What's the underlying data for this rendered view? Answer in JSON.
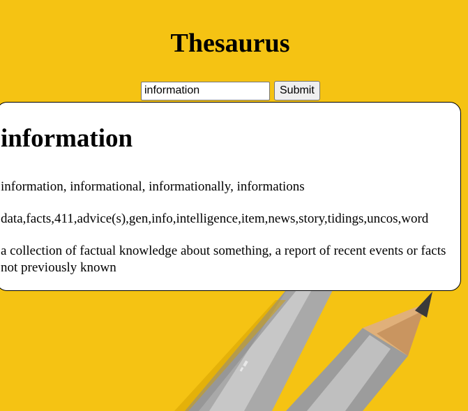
{
  "header": {
    "title": "Thesaurus"
  },
  "search": {
    "value": "information",
    "submit_label": "Submit"
  },
  "result": {
    "word": "information",
    "forms": "information, informational, informationally, informations",
    "synonyms": "data,facts,411,advice(s),gen,info,intelligence,item,news,story,tidings,uncos,word",
    "definition": "a collection of factual knowledge about something, a report of recent events or facts not previously known"
  },
  "colors": {
    "background": "#f5c10e",
    "card": "#ffffff"
  }
}
